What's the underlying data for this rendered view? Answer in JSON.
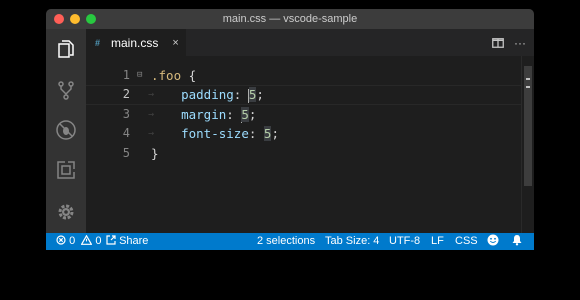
{
  "window": {
    "title": "main.css — vscode-sample"
  },
  "activity_bar": {
    "items": [
      {
        "icon": "files-icon"
      },
      {
        "icon": "source-control-icon"
      },
      {
        "icon": "debug-icon"
      },
      {
        "icon": "extensions-icon"
      },
      {
        "icon": "settings-icon"
      }
    ]
  },
  "tab": {
    "label": "main.css",
    "close": "×",
    "file_icon": "#"
  },
  "editor_actions": {
    "split": "split-editor-icon",
    "more": "···"
  },
  "editor": {
    "lines": [
      {
        "number": "1",
        "tokens": [
          {
            "t": ".foo",
            "c": "sel"
          },
          {
            "t": " {",
            "c": ""
          }
        ]
      },
      {
        "number": "2",
        "tokens": [
          {
            "t": "    ",
            "c": ""
          },
          {
            "t": "padding",
            "c": "prop"
          },
          {
            "t": ": ",
            "c": ""
          },
          {
            "t": "5",
            "c": "num"
          },
          {
            "t": ";",
            "c": ""
          }
        ]
      },
      {
        "number": "3",
        "tokens": [
          {
            "t": "    ",
            "c": ""
          },
          {
            "t": "margin",
            "c": "prop"
          },
          {
            "t": ": ",
            "c": ""
          },
          {
            "t": "5",
            "c": "num"
          },
          {
            "t": ";",
            "c": ""
          }
        ]
      },
      {
        "number": "4",
        "tokens": [
          {
            "t": "    ",
            "c": ""
          },
          {
            "t": "font-size",
            "c": "prop"
          },
          {
            "t": ": ",
            "c": ""
          },
          {
            "t": "5",
            "c": "num"
          },
          {
            "t": ";",
            "c": ""
          }
        ]
      },
      {
        "number": "5",
        "tokens": [
          {
            "t": "}",
            "c": ""
          }
        ]
      }
    ],
    "active_line": "2"
  },
  "status_bar": {
    "errors": "0",
    "warnings": "0",
    "share": "Share",
    "selections": "2 selections",
    "tab_size": "Tab Size: 4",
    "encoding": "UTF-8",
    "eol": "LF",
    "language": "CSS"
  },
  "colors": {
    "accent": "#007acc",
    "selector": "#d7ba7d",
    "property": "#9cdcfe",
    "number": "#b5cea8"
  }
}
